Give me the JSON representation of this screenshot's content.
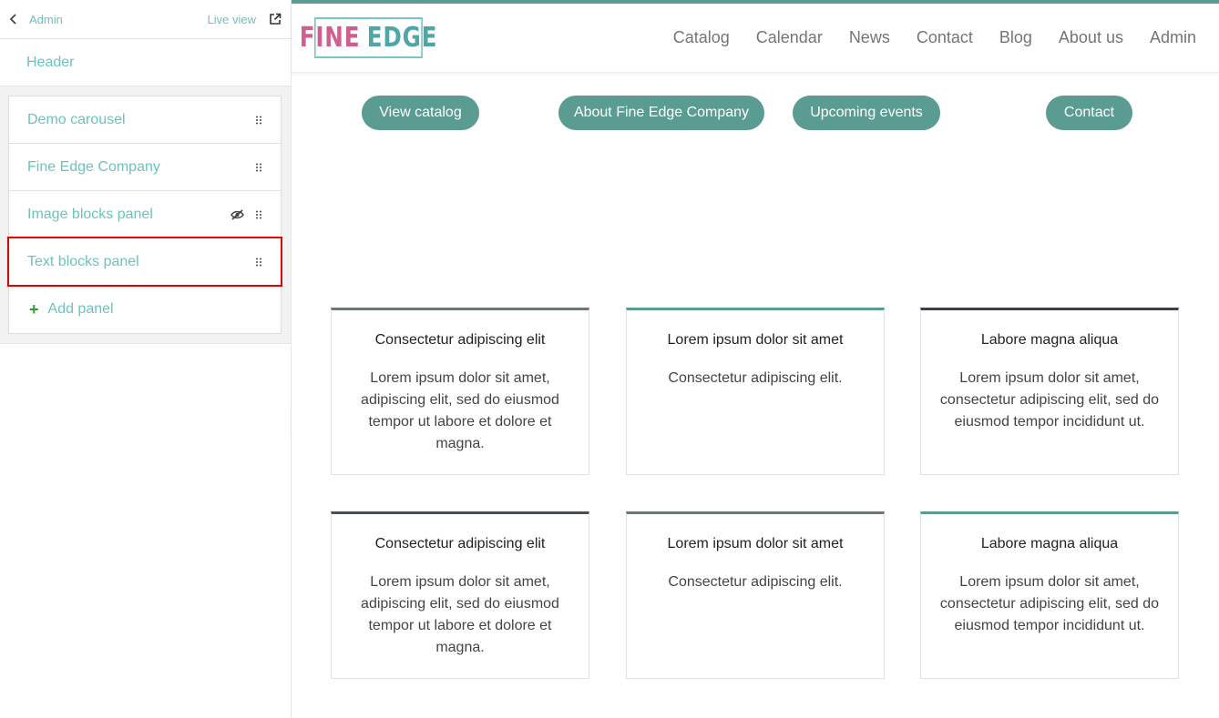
{
  "sidebar": {
    "back_label": "Admin",
    "live_view_label": "Live view",
    "header_label": "Header",
    "panels": [
      {
        "label": "Demo carousel"
      },
      {
        "label": "Fine Edge Company"
      },
      {
        "label": "Image blocks panel"
      },
      {
        "label": "Text blocks panel"
      }
    ],
    "add_panel_label": "Add panel"
  },
  "site": {
    "logo": {
      "part1": "FINE",
      "part2": "EDGE"
    },
    "nav": [
      "Catalog",
      "Calendar",
      "News",
      "Contact",
      "Blog",
      "About us",
      "Admin"
    ],
    "buttons": [
      "View catalog",
      "About Fine Edge Company",
      "Upcoming events",
      "Contact"
    ],
    "cards": [
      {
        "title": "Consectetur adipiscing elit",
        "text": "Lorem ipsum dolor sit amet, adipiscing elit, sed do eiusmod tempor ut labore et dolore et magna.",
        "accent": "#6f7676"
      },
      {
        "title": "Lorem ipsum dolor sit amet",
        "text": "Consectetur adipiscing elit.",
        "accent": "#5c9c93"
      },
      {
        "title": "Labore magna aliqua",
        "text": "Lorem ipsum dolor sit amet, consectetur adipiscing elit, sed do eiusmod tempor incididunt ut.",
        "accent": "#3b3f45"
      },
      {
        "title": "Consectetur adipiscing elit",
        "text": "Lorem ipsum dolor sit amet, adipiscing elit, sed do eiusmod tempor ut labore et dolore et magna.",
        "accent": "#4a4f55"
      },
      {
        "title": "Lorem ipsum dolor sit amet",
        "text": "Consectetur adipiscing elit.",
        "accent": "#6f7676"
      },
      {
        "title": "Labore magna aliqua",
        "text": "Lorem ipsum dolor sit amet, consectetur adipiscing elit, sed do eiusmod tempor incididunt ut.",
        "accent": "#5c9c93"
      }
    ]
  },
  "colors": {
    "accent": "#6cc3bd",
    "button": "#5a9b92",
    "selection": "#e00000"
  }
}
